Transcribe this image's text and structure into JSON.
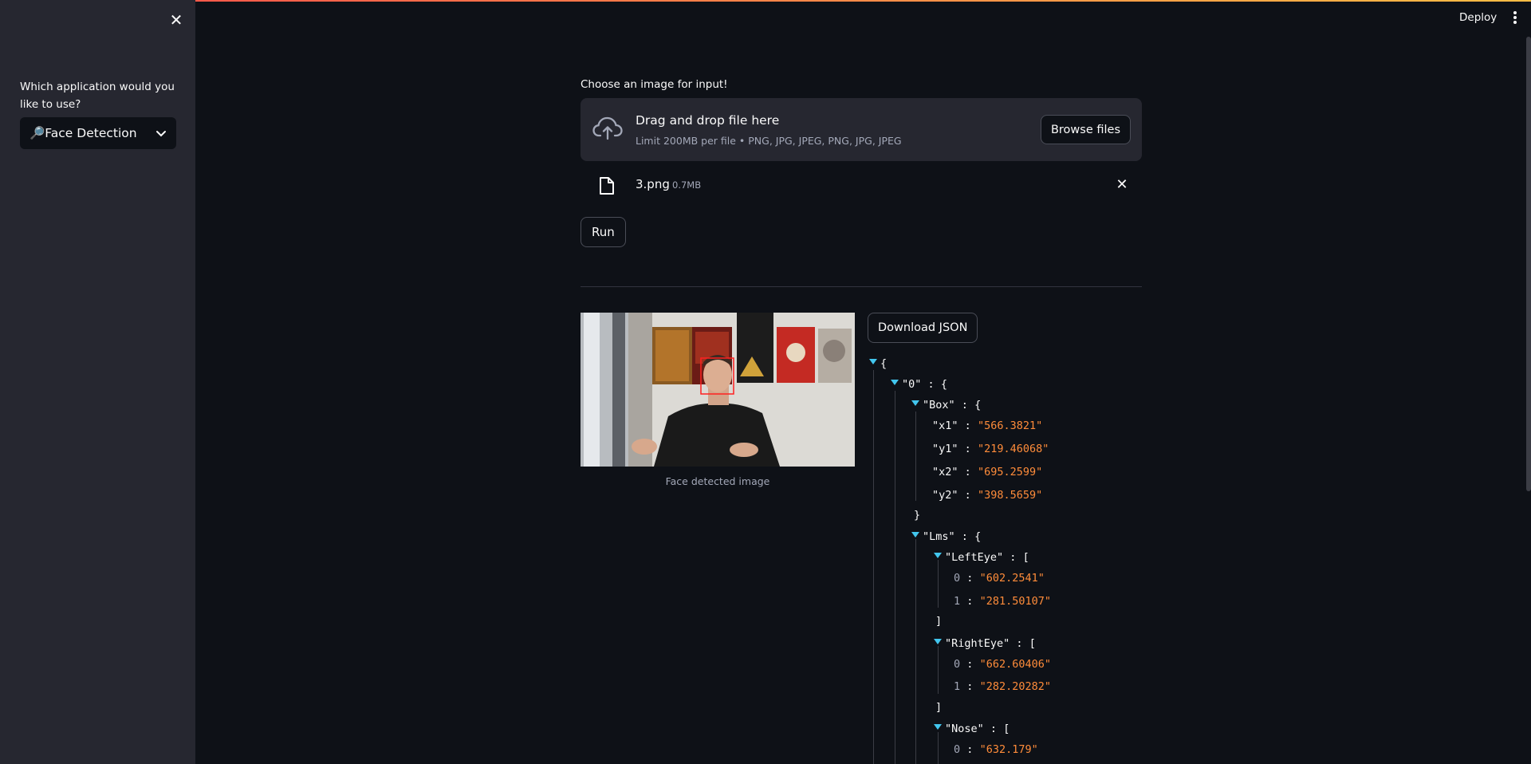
{
  "sidebar": {
    "close_icon": "close-icon",
    "question": "Which application would you like to use?",
    "select_value": "🔎Face Detection"
  },
  "header": {
    "deploy": "Deploy",
    "menu_icon": "vertical-dots-icon"
  },
  "uploader": {
    "label": "Choose an image for input!",
    "drop_title": "Drag and drop file here",
    "limit": "Limit 200MB per file • PNG, JPG, JPEG, PNG, JPG, JPEG",
    "browse": "Browse files",
    "file_name": "3.png",
    "file_size": "0.7MB"
  },
  "run_label": "Run",
  "image_caption": "Face detected image",
  "download_label": "Download JSON",
  "json": {
    "open_brace": "{",
    "close_brace": "}",
    "open_bracket": "[",
    "close_bracket": "]",
    "colon": ":",
    "key_0": "\"0\"",
    "key_box": "\"Box\"",
    "key_x1": "\"x1\"",
    "val_x1": "\"566.3821\"",
    "key_y1": "\"y1\"",
    "val_y1": "\"219.46068\"",
    "key_x2": "\"x2\"",
    "val_x2": "\"695.2599\"",
    "key_y2": "\"y2\"",
    "val_y2": "\"398.5659\"",
    "key_lms": "\"Lms\"",
    "key_lefteye": "\"LeftEye\"",
    "le_0": "\"602.2541\"",
    "le_1": "\"281.50107\"",
    "key_righteye": "\"RightEye\"",
    "re_0": "\"662.60406\"",
    "re_1": "\"282.20282\"",
    "key_nose": "\"Nose\"",
    "nose_0": "\"632.179\"",
    "idx0": "0",
    "idx1": "1"
  },
  "colors": {
    "background": "#0e1117",
    "sidebar": "#262730",
    "string": "#ff8c3a",
    "toggle": "#42c6ee",
    "box": "#ff2020"
  }
}
